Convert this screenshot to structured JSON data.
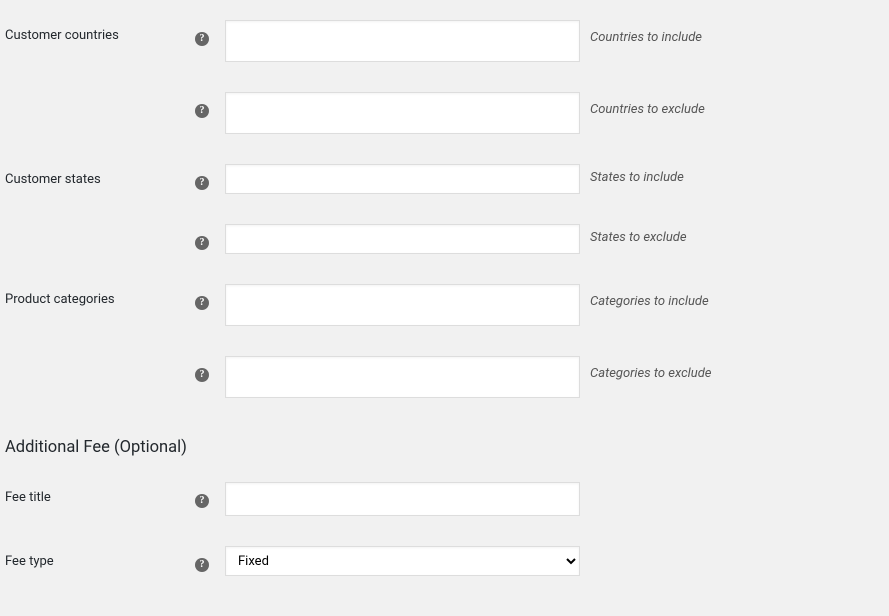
{
  "rows": {
    "customer_countries": {
      "label": "Customer countries"
    },
    "countries_include": {
      "desc": "Countries to include",
      "value": ""
    },
    "countries_exclude": {
      "desc": "Countries to exclude",
      "value": ""
    },
    "customer_states": {
      "label": "Customer states"
    },
    "states_include": {
      "desc": "States to include",
      "value": ""
    },
    "states_exclude": {
      "desc": "States to exclude",
      "value": ""
    },
    "product_categories": {
      "label": "Product categories"
    },
    "categories_include": {
      "desc": "Categories to include",
      "value": ""
    },
    "categories_exclude": {
      "desc": "Categories to exclude",
      "value": ""
    },
    "fee_title": {
      "label": "Fee title",
      "value": ""
    },
    "fee_type": {
      "label": "Fee type",
      "selected": "Fixed"
    }
  },
  "section_heading": "Additional Fee (Optional)"
}
